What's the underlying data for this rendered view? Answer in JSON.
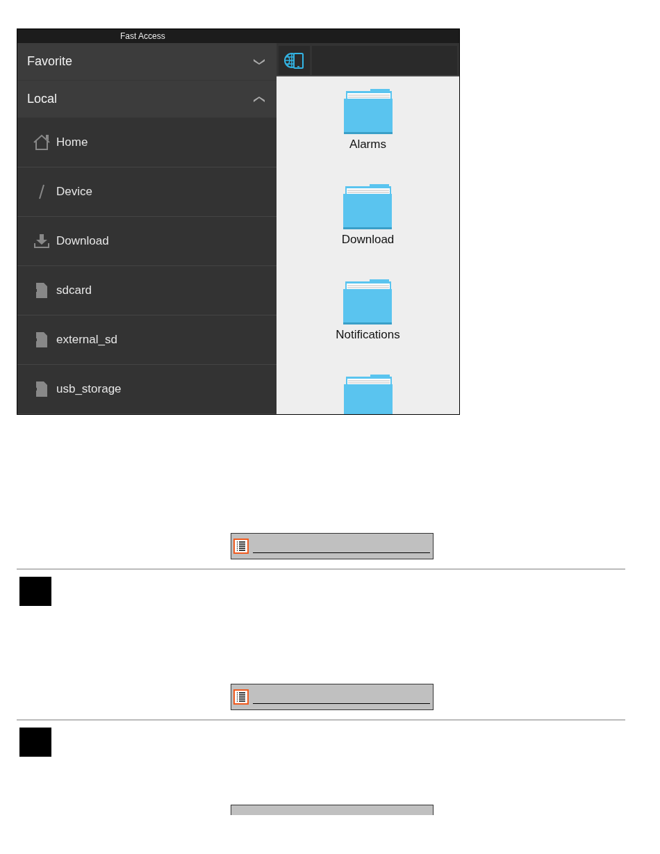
{
  "app": {
    "title": "Fast Access",
    "sections": [
      {
        "label": "Favorite",
        "expanded": false
      },
      {
        "label": "Local",
        "expanded": true
      }
    ],
    "places": [
      {
        "label": "Home",
        "kind": "home"
      },
      {
        "label": "Device",
        "kind": "root"
      },
      {
        "label": "Download",
        "kind": "download"
      },
      {
        "label": "sdcard",
        "kind": "card"
      },
      {
        "label": "external_sd",
        "kind": "card"
      },
      {
        "label": "usb_storage",
        "kind": "card"
      }
    ],
    "folders": [
      {
        "kind": "folder",
        "label": "Alarms"
      },
      {
        "kind": "folder",
        "label": "Download"
      },
      {
        "kind": "folder",
        "label": "Notifications"
      },
      {
        "kind": "folder"
      }
    ]
  },
  "doc_blocks": [
    {
      "kind": "listbar"
    },
    {
      "kind": "marker"
    },
    {
      "kind": "listbar"
    },
    {
      "kind": "marker"
    },
    {
      "kind": "bar"
    }
  ]
}
